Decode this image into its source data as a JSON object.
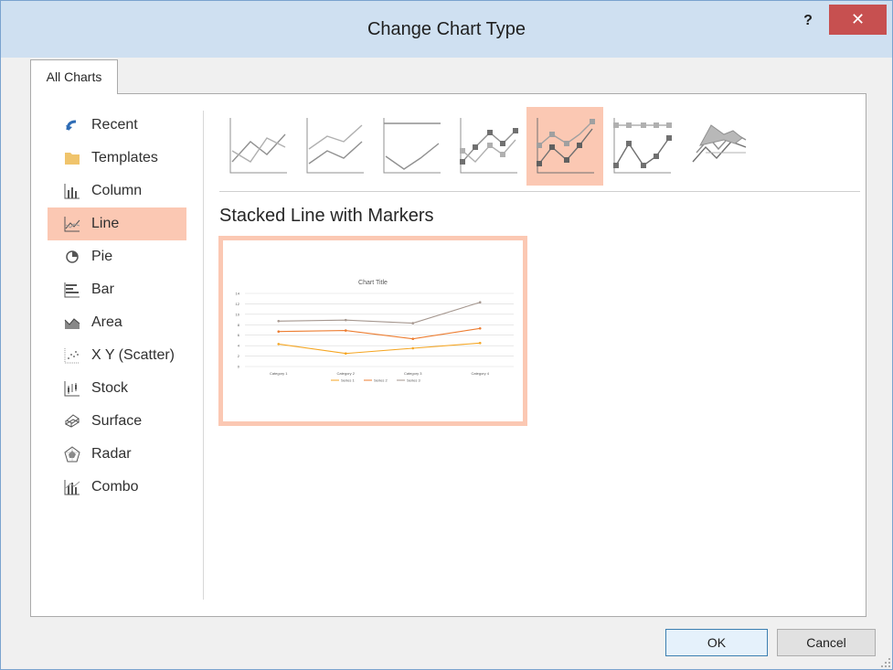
{
  "dialog": {
    "title": "Change Chart Type",
    "help": "?",
    "close": "✕"
  },
  "tab": {
    "label": "All Charts"
  },
  "sidebar": {
    "items": [
      {
        "label": "Recent",
        "icon": "recent-icon"
      },
      {
        "label": "Templates",
        "icon": "folder-icon"
      },
      {
        "label": "Column",
        "icon": "column-chart-icon"
      },
      {
        "label": "Line",
        "icon": "line-chart-icon",
        "selected": true
      },
      {
        "label": "Pie",
        "icon": "pie-chart-icon"
      },
      {
        "label": "Bar",
        "icon": "bar-chart-icon"
      },
      {
        "label": "Area",
        "icon": "area-chart-icon"
      },
      {
        "label": "X Y (Scatter)",
        "icon": "scatter-chart-icon"
      },
      {
        "label": "Stock",
        "icon": "stock-chart-icon"
      },
      {
        "label": "Surface",
        "icon": "surface-chart-icon"
      },
      {
        "label": "Radar",
        "icon": "radar-chart-icon"
      },
      {
        "label": "Combo",
        "icon": "combo-chart-icon"
      }
    ]
  },
  "subtypes": [
    {
      "icon": "line-subtype-icon"
    },
    {
      "icon": "stacked-line-subtype-icon"
    },
    {
      "icon": "100-stacked-line-subtype-icon"
    },
    {
      "icon": "line-with-markers-subtype-icon"
    },
    {
      "icon": "stacked-line-with-markers-subtype-icon",
      "selected": true
    },
    {
      "icon": "100-stacked-line-with-markers-subtype-icon"
    },
    {
      "icon": "3d-line-subtype-icon"
    }
  ],
  "preview": {
    "title": "Stacked Line with Markers",
    "chart_data": {
      "type": "line",
      "title": "Chart Title",
      "categories": [
        "Category 1",
        "Category 2",
        "Category 3",
        "Category 4"
      ],
      "ylim": [
        0,
        14
      ],
      "yticks": [
        0,
        2,
        4,
        6,
        8,
        10,
        12,
        14
      ],
      "grid": true,
      "legend": "bottom",
      "series": [
        {
          "name": "Series 1",
          "values": [
            4.3,
            2.5,
            3.5,
            4.5
          ],
          "color": "#f5a623"
        },
        {
          "name": "Series 2",
          "values": [
            6.7,
            6.9,
            5.3,
            7.3
          ],
          "color": "#ed7d31"
        },
        {
          "name": "Series 3",
          "values": [
            8.7,
            8.9,
            8.3,
            12.3
          ],
          "color": "#a5978f"
        }
      ]
    }
  },
  "buttons": {
    "ok": "OK",
    "cancel": "Cancel"
  },
  "colors": {
    "accent": "#fbc8b3",
    "close": "#c75050",
    "titlebar": "#cfe0f1"
  }
}
